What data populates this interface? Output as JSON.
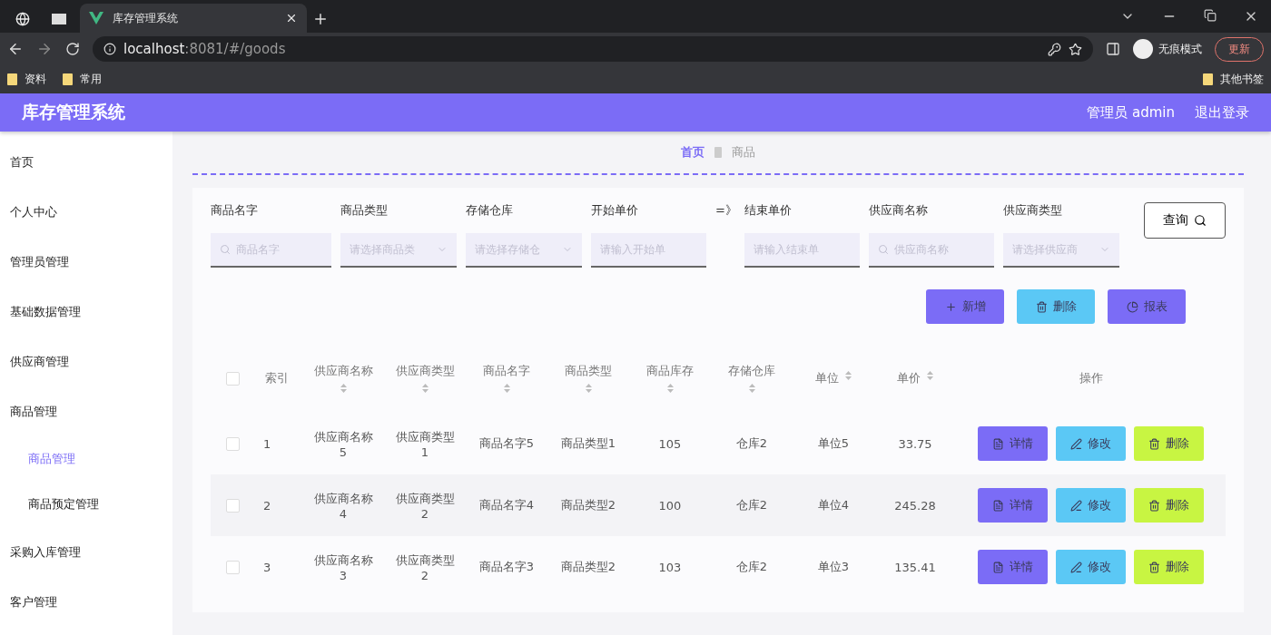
{
  "browser": {
    "tab_title": "库存管理系统",
    "url_host": "localhost",
    "url_path": ":8081/#/goods",
    "incognito": "无痕模式",
    "update": "更新",
    "bookmarks": [
      "资料",
      "常用"
    ],
    "other_bookmarks": "其他书签"
  },
  "header": {
    "title": "库存管理系统",
    "user": "管理员 admin",
    "logout": "退出登录"
  },
  "sidebar": {
    "items": [
      {
        "label": "首页",
        "selected": false
      },
      {
        "label": "个人中心",
        "selected": false
      },
      {
        "label": "管理员管理",
        "selected": false
      },
      {
        "label": "基础数据管理",
        "selected": false
      },
      {
        "label": "供应商管理",
        "selected": false
      },
      {
        "label": "商品管理",
        "selected": false,
        "children": [
          {
            "label": "商品管理",
            "selected": true
          },
          {
            "label": "商品预定管理",
            "selected": false
          }
        ]
      },
      {
        "label": "采购入库管理",
        "selected": false
      },
      {
        "label": "客户管理",
        "selected": false
      }
    ]
  },
  "breadcrumb": [
    "首页",
    "商品"
  ],
  "filters": [
    {
      "kind": "search",
      "label": "商品名字",
      "placeholder": "商品名字"
    },
    {
      "kind": "select",
      "label": "商品类型",
      "placeholder": "请选择商品类"
    },
    {
      "kind": "select",
      "label": "存储仓库",
      "placeholder": "请选择存储仓"
    },
    {
      "kind": "input",
      "label": "开始单价",
      "placeholder": "请输入开始单"
    },
    {
      "kind": "separator",
      "label": "=》"
    },
    {
      "kind": "input",
      "label": "结束单价",
      "placeholder": "请输入结束单"
    },
    {
      "kind": "search",
      "label": "供应商名称",
      "placeholder": "供应商名称"
    },
    {
      "kind": "select",
      "label": "供应商类型",
      "placeholder": "请选择供应商"
    }
  ],
  "query_button": "查询",
  "actions": [
    {
      "kind": "add",
      "label": "新增"
    },
    {
      "kind": "delete",
      "label": "删除"
    },
    {
      "kind": "report",
      "label": "报表"
    }
  ],
  "table": {
    "select_all_checked": false,
    "columns": [
      {
        "label": "索引",
        "sortable": false
      },
      {
        "label": "供应商名称",
        "sortable": true
      },
      {
        "label": "供应商类型",
        "sortable": true
      },
      {
        "label": "商品名字",
        "sortable": true
      },
      {
        "label": "商品类型",
        "sortable": true
      },
      {
        "label": "商品库存",
        "sortable": true
      },
      {
        "label": "存储仓库",
        "sortable": true
      },
      {
        "label": "单位",
        "sortable": true
      },
      {
        "label": "单价",
        "sortable": true
      },
      {
        "label": "操作",
        "sortable": false
      }
    ],
    "rows": [
      {
        "checked": false,
        "cells": [
          "1",
          "供应商名称5",
          "供应商类型1",
          "商品名字5",
          "商品类型1",
          "105",
          "仓库2",
          "单位5",
          "33.75"
        ],
        "actions": [
          {
            "kind": "detail",
            "label": "详情"
          },
          {
            "kind": "edit",
            "label": "修改"
          },
          {
            "kind": "delete",
            "label": "删除"
          }
        ]
      },
      {
        "checked": false,
        "cells": [
          "2",
          "供应商名称4",
          "供应商类型2",
          "商品名字4",
          "商品类型2",
          "100",
          "仓库2",
          "单位4",
          "245.28"
        ],
        "actions": [
          {
            "kind": "detail",
            "label": "详情"
          },
          {
            "kind": "edit",
            "label": "修改"
          },
          {
            "kind": "delete",
            "label": "删除"
          }
        ]
      },
      {
        "checked": false,
        "cells": [
          "3",
          "供应商名称3",
          "供应商类型2",
          "商品名字3",
          "商品类型2",
          "103",
          "仓库2",
          "单位3",
          "135.41"
        ],
        "actions": [
          {
            "kind": "detail",
            "label": "详情"
          },
          {
            "kind": "edit",
            "label": "修改"
          },
          {
            "kind": "delete",
            "label": "删除"
          }
        ]
      }
    ]
  }
}
